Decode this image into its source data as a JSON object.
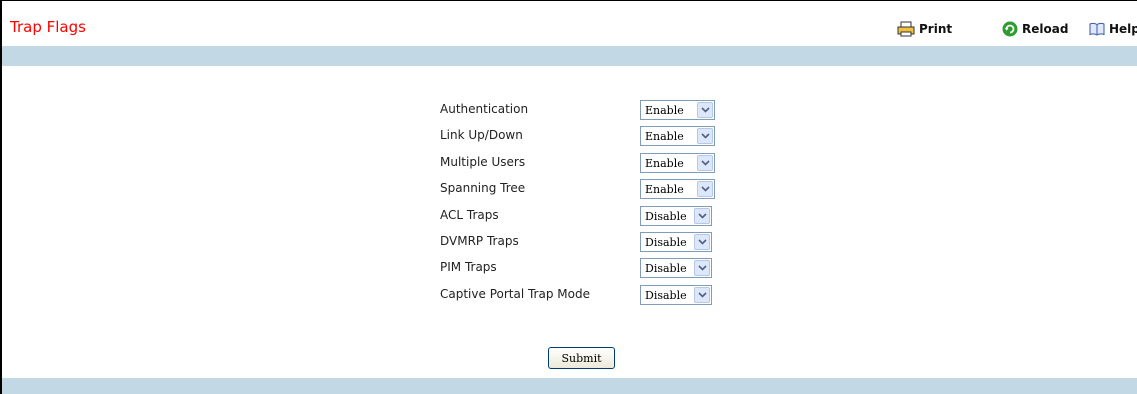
{
  "page": {
    "title": "Trap Flags"
  },
  "toolbar": {
    "print_label": "Print",
    "reload_label": "Reload",
    "help_label": "Help"
  },
  "colors": {
    "title": "#ff0000",
    "band": "#c2d8e4",
    "select_border": "#7f9db9"
  },
  "form": {
    "rows": [
      {
        "label": "Authentication",
        "value": "Enable"
      },
      {
        "label": "Link Up/Down",
        "value": "Enable"
      },
      {
        "label": "Multiple Users",
        "value": "Enable"
      },
      {
        "label": "Spanning Tree",
        "value": "Enable"
      },
      {
        "label": "ACL Traps",
        "value": "Disable"
      },
      {
        "label": "DVMRP Traps",
        "value": "Disable"
      },
      {
        "label": "PIM Traps",
        "value": "Disable"
      },
      {
        "label": "Captive Portal Trap Mode",
        "value": "Disable"
      }
    ],
    "submit_label": "Submit"
  }
}
